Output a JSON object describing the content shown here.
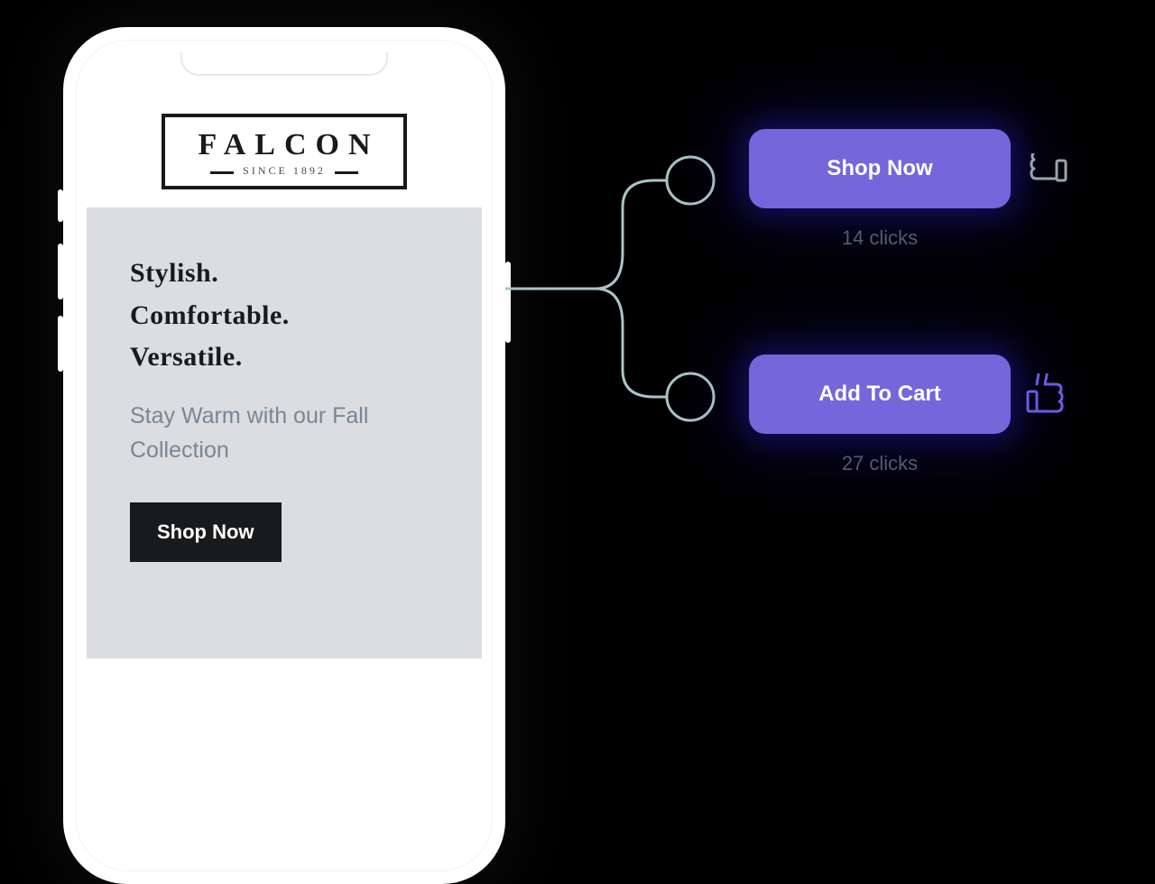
{
  "phone": {
    "brand": "FALCON",
    "since": "SINCE 1892",
    "headline1": "Stylish.",
    "headline2": "Comfortable.",
    "headline3": "Versatile.",
    "subhead": "Stay Warm with our Fall Collection",
    "cta": "Shop Now"
  },
  "variants": {
    "a": {
      "label": "Shop Now",
      "clicks": "14 clicks",
      "result": "loser"
    },
    "b": {
      "label": "Add To Cart",
      "clicks": "27 clicks",
      "result": "winner"
    }
  }
}
